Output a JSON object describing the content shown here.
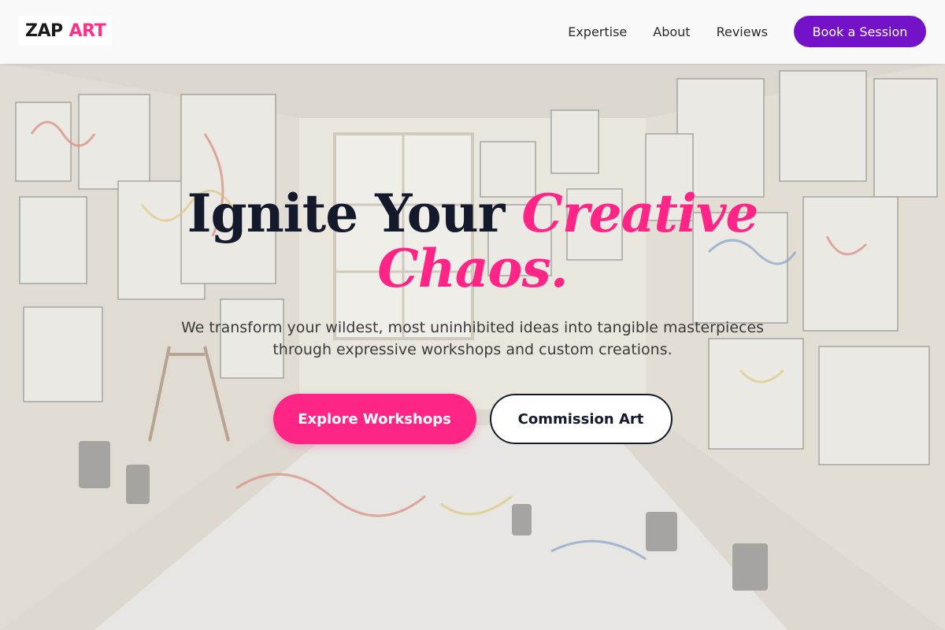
{
  "brand": {
    "first": "ZAP",
    "second": "ART"
  },
  "nav": {
    "links": [
      "Expertise",
      "About",
      "Reviews"
    ],
    "cta": "Book a Session"
  },
  "hero": {
    "headline_plain": "Ignite Your",
    "headline_accent_1": "Creative",
    "headline_accent_2": "Chaos.",
    "subhead_line1": "We transform your wildest, most uninhibited ideas into tangible masterpieces",
    "subhead_line2": "through expressive workshops and custom creations.",
    "primary_button": "Explore Workshops",
    "secondary_button": "Commission Art",
    "background_image": "art-studio-photo"
  },
  "colors": {
    "accent_pink": "#ff2586",
    "cta_purple": "#7312c8",
    "heading_dark": "#141a2c"
  }
}
